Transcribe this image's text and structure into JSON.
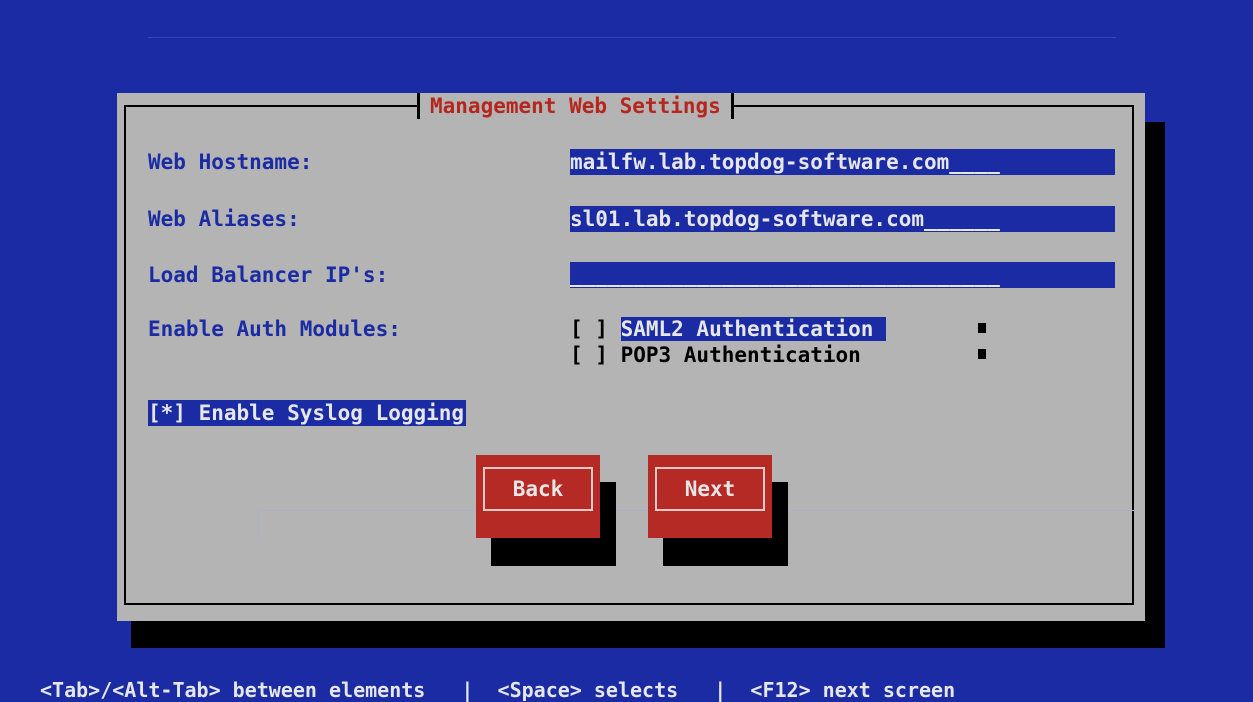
{
  "dialog": {
    "title": "Management Web Settings",
    "fields": [
      {
        "label": "Web Hostname:",
        "value": "mailfw.lab.topdog-software.com____"
      },
      {
        "label": "Web Aliases:",
        "value": "sl01.lab.topdog-software.com______"
      },
      {
        "label": "Load Balancer IP's:",
        "value": "__________________________________"
      }
    ],
    "auth_modules": {
      "label": "Enable Auth Modules:",
      "options": [
        {
          "box": "[ ] ",
          "label": "SAML2 Authentication ",
          "checked": false
        },
        {
          "box": "[ ] ",
          "label": "POP3 Authentication ",
          "checked": false
        }
      ]
    },
    "syslog": {
      "text": "[*] Enable Syslog Logging",
      "checked": true
    },
    "buttons": {
      "back": "Back",
      "next": "Next"
    }
  },
  "help_bar": "<Tab>/<Alt-Tab> between elements   |  <Space> selects   |  <F12> next screen",
  "colors": {
    "background": "#1a2ba3",
    "dialog": "#b4b4b4",
    "title": "#b5261e",
    "button": "#b52a25",
    "field": "#1a2ba3"
  }
}
